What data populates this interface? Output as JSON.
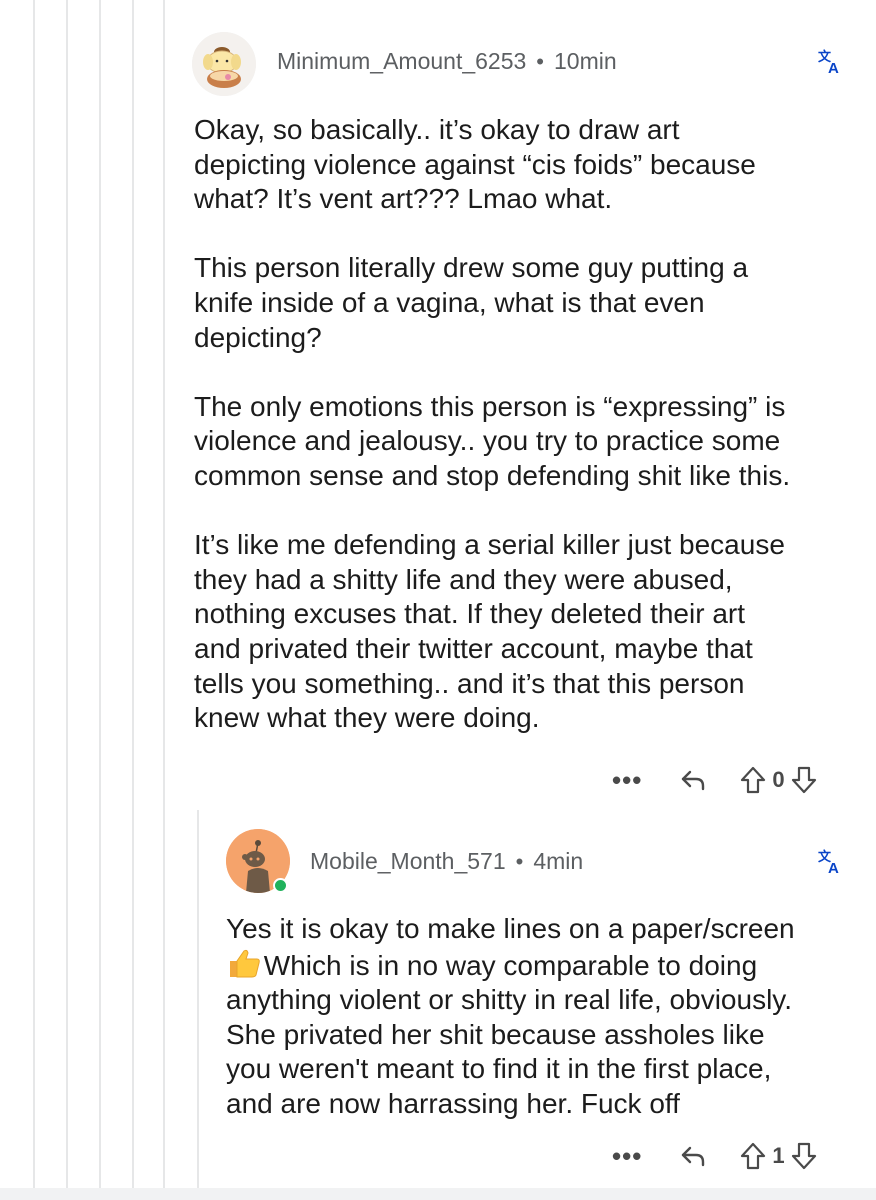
{
  "comments": [
    {
      "username": "Minimum_Amount_6253",
      "separator": "•",
      "time": "10min",
      "translate_icon": "translate-icon",
      "paragraphs": [
        [
          "Okay, so basically.. it’s okay to draw art",
          "depicting violence against “cis foids” because",
          "what? It’s vent art??? Lmao what."
        ],
        [
          "This person literally drew some guy putting a",
          "knife inside of a vagina, what is that even",
          "depicting?"
        ],
        [
          "The only emotions this person is “expressing” is",
          "violence and jealousy.. you try to practice some",
          "common sense and stop defending shit like this."
        ],
        [
          "It’s like me defending a serial killer just because",
          "they had a shitty life and they were abused,",
          "nothing excuses that. If they deleted their art",
          "and privated their twitter account, maybe that",
          "tells you something.. and it’s that this person",
          "knew what they were doing."
        ]
      ],
      "actions": {
        "more": "•••",
        "reply_icon": "reply-icon",
        "upvote_icon": "upvote-icon",
        "vote_count": "0",
        "downvote_icon": "downvote-icon"
      }
    },
    {
      "username": "Mobile_Month_571",
      "separator": "•",
      "time": "4min",
      "translate_icon": "translate-icon",
      "online": true,
      "lines": [
        "Yes it is okay to make lines on a paper/screen",
        " Which is in no way comparable to doing",
        "anything violent or shitty in real life, obviously.",
        "She privated her shit because assholes like",
        "you weren't meant to find it in the first place,",
        "and are now harrassing her. Fuck off"
      ],
      "emoji": "thumbs-up",
      "actions": {
        "more": "•••",
        "reply_icon": "reply-icon",
        "upvote_icon": "upvote-icon",
        "vote_count": "1",
        "downvote_icon": "downvote-icon"
      }
    }
  ],
  "colors": {
    "meta_text": "#5c5f62",
    "translate": "#0a45c8",
    "thread_line": "#e6e7e8",
    "online": "#20b25c"
  }
}
